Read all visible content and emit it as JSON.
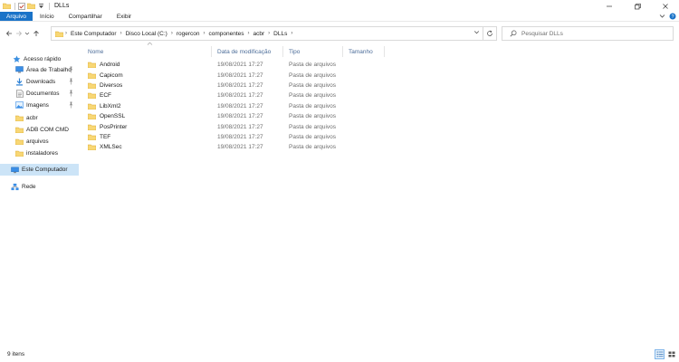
{
  "window": {
    "title": "DLLs"
  },
  "ribbon": {
    "tabs": [
      {
        "label": "Arquivo",
        "active": true
      },
      {
        "label": "Início",
        "active": false
      },
      {
        "label": "Compartilhar",
        "active": false
      },
      {
        "label": "Exibir",
        "active": false
      }
    ]
  },
  "address": {
    "breadcrumbs": [
      "Este Computador",
      "Disco Local (C:)",
      "rogercon",
      "componentes",
      "acbr",
      "DLLs"
    ]
  },
  "search": {
    "placeholder": "Pesquisar DLLs"
  },
  "nav": {
    "items": [
      {
        "label": "Acesso rápido",
        "icon": "star-icon",
        "pinned": false
      },
      {
        "label": "Área de Trabalho",
        "icon": "desktop-icon",
        "pinned": true
      },
      {
        "label": "Downloads",
        "icon": "download-icon",
        "pinned": true
      },
      {
        "label": "Documentos",
        "icon": "documents-icon",
        "pinned": true
      },
      {
        "label": "Imagens",
        "icon": "pictures-icon",
        "pinned": true
      },
      {
        "label": "acbr",
        "icon": "folder-icon",
        "pinned": false
      },
      {
        "label": "ADB COM CMD",
        "icon": "folder-icon",
        "pinned": false
      },
      {
        "label": "arquivos",
        "icon": "folder-icon",
        "pinned": false
      },
      {
        "label": "instaladores",
        "icon": "folder-icon",
        "pinned": false
      },
      {
        "label": "Este Computador",
        "icon": "computer-icon",
        "pinned": false,
        "selected": true
      },
      {
        "label": "Rede",
        "icon": "network-icon",
        "pinned": false
      }
    ]
  },
  "columns": [
    "Nome",
    "Data de modificação",
    "Tipo",
    "Tamanho"
  ],
  "files": [
    {
      "name": "Android",
      "date": "19/08/2021 17:27",
      "type": "Pasta de arquivos",
      "size": ""
    },
    {
      "name": "Capicom",
      "date": "19/08/2021 17:27",
      "type": "Pasta de arquivos",
      "size": ""
    },
    {
      "name": "Diversos",
      "date": "19/08/2021 17:27",
      "type": "Pasta de arquivos",
      "size": ""
    },
    {
      "name": "ECF",
      "date": "19/08/2021 17:27",
      "type": "Pasta de arquivos",
      "size": ""
    },
    {
      "name": "LibXml2",
      "date": "19/08/2021 17:27",
      "type": "Pasta de arquivos",
      "size": ""
    },
    {
      "name": "OpenSSL",
      "date": "19/08/2021 17:27",
      "type": "Pasta de arquivos",
      "size": ""
    },
    {
      "name": "PosPrinter",
      "date": "19/08/2021 17:27",
      "type": "Pasta de arquivos",
      "size": ""
    },
    {
      "name": "TEF",
      "date": "19/08/2021 17:27",
      "type": "Pasta de arquivos",
      "size": ""
    },
    {
      "name": "XMLSec",
      "date": "19/08/2021 17:27",
      "type": "Pasta de arquivos",
      "size": ""
    }
  ],
  "status": {
    "item_count": "9 itens"
  },
  "colors": {
    "accent": "#1a73c8",
    "folder": "#f8d775",
    "selection": "#cce4f7"
  }
}
